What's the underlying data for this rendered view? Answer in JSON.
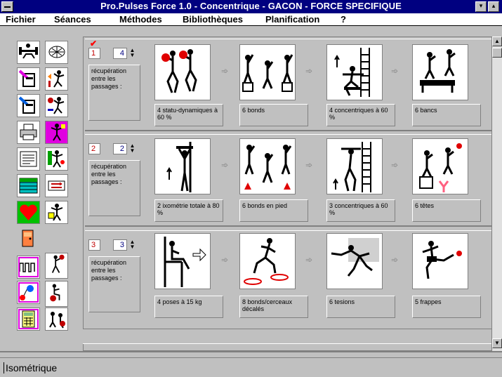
{
  "window": {
    "title": "Pro.Pulses Force 1.0 - Concentrique - GACON - FORCE SPECIFIQUE",
    "minimize_glyph": "▾",
    "maximize_glyph": "▴"
  },
  "menu": [
    {
      "label": "Fichier"
    },
    {
      "label": "Séances"
    },
    {
      "label": "Méthodes"
    },
    {
      "label": "Bibliothèques"
    },
    {
      "label": "Planification"
    },
    {
      "label": "?"
    }
  ],
  "toolbar": {
    "icons": [
      "weight-bench-icon",
      "skeleton-icon",
      "trainer-pink-icon",
      "muscles-jump-icon",
      "trainer-blue-icon",
      "muscles-ball-icon",
      "printer-icon",
      "muscles-magenta-icon",
      "document-list-icon",
      "muscles-green-icon",
      "calendar-grid-icon",
      "arrows-switch-icon",
      "heart-icon",
      "muscles-yellow-icon",
      "exit-door-icon",
      "pulse-chart-icon",
      "throw-athlete-icon",
      "lollipop-chart-icon",
      "seated-athlete-icon",
      "calculator-icon",
      "group-athletes-icon"
    ]
  },
  "seances": [
    {
      "number": "1",
      "count": "4",
      "checked": true,
      "recuperation": "récupération entre les passages :",
      "exercises": [
        {
          "label": "4 statu-dynamiques à 60 %",
          "icon": "jump-squat-icon"
        },
        {
          "label": "6 bonds",
          "icon": "box-jumps-icon"
        },
        {
          "label": "4 concentriques à 60 %",
          "icon": "rack-squat-icon"
        },
        {
          "label": "6 bancs",
          "icon": "bench-jump-icon"
        }
      ]
    },
    {
      "number": "2",
      "count": "2",
      "checked": false,
      "recuperation": "récupération entre les passages :",
      "exercises": [
        {
          "label": "2 ixométrie totale à 80 %",
          "icon": "isometric-squat-icon"
        },
        {
          "label": "6 bonds en pied",
          "icon": "cone-jumps-icon"
        },
        {
          "label": "3 concentriques à 60 %",
          "icon": "rack-press-icon"
        },
        {
          "label": "6 têtes",
          "icon": "header-jump-icon"
        }
      ]
    },
    {
      "number": "3",
      "count": "3",
      "checked": false,
      "recuperation": "récupération entre les passages :",
      "exercises": [
        {
          "label": "4 poses à 15 kg",
          "icon": "leg-extension-icon"
        },
        {
          "label": "8 bonds/cerceaux décalés",
          "icon": "hoop-jumps-icon"
        },
        {
          "label": "6 tesions",
          "icon": "tackle-icon"
        },
        {
          "label": "5 frappes",
          "icon": "kick-icon"
        }
      ]
    }
  ],
  "status": {
    "text": "Isométrique"
  },
  "colors": {
    "title_bg": "#000080",
    "window_bg": "#c0c0c0",
    "number_red": "#c00000",
    "count_blue": "#000080"
  }
}
